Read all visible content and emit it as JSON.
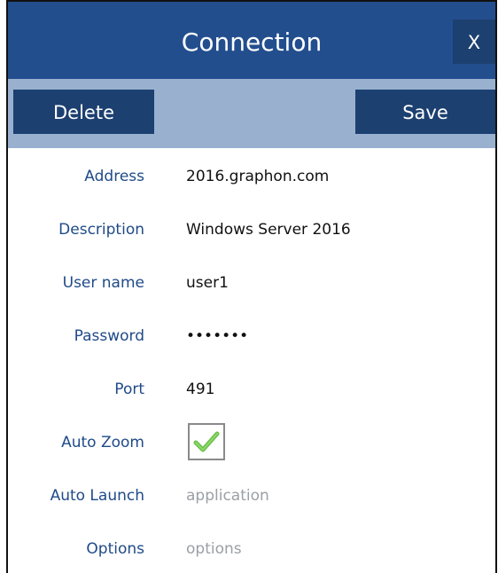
{
  "window": {
    "title": "Connection",
    "close_label": "X"
  },
  "toolbar": {
    "delete_label": "Delete",
    "save_label": "Save"
  },
  "form": {
    "address": {
      "label": "Address",
      "value": "2016.graphon.com"
    },
    "description": {
      "label": "Description",
      "value": "Windows Server 2016"
    },
    "username": {
      "label": "User name",
      "value": "user1"
    },
    "password": {
      "label": "Password",
      "value": "•••••••"
    },
    "port": {
      "label": "Port",
      "value": "491"
    },
    "auto_zoom": {
      "label": "Auto Zoom",
      "checked": true
    },
    "auto_launch": {
      "label": "Auto Launch",
      "placeholder": "application"
    },
    "options": {
      "label": "Options",
      "placeholder": "options"
    }
  },
  "colors": {
    "title_bar": "#234e8e",
    "button": "#1c4070",
    "toolbar_bg": "#99b1cf",
    "label_text": "#1f4a88",
    "checkmark": "#6cc24a"
  },
  "icons": {
    "close": "close-icon",
    "check": "checkmark-icon"
  }
}
